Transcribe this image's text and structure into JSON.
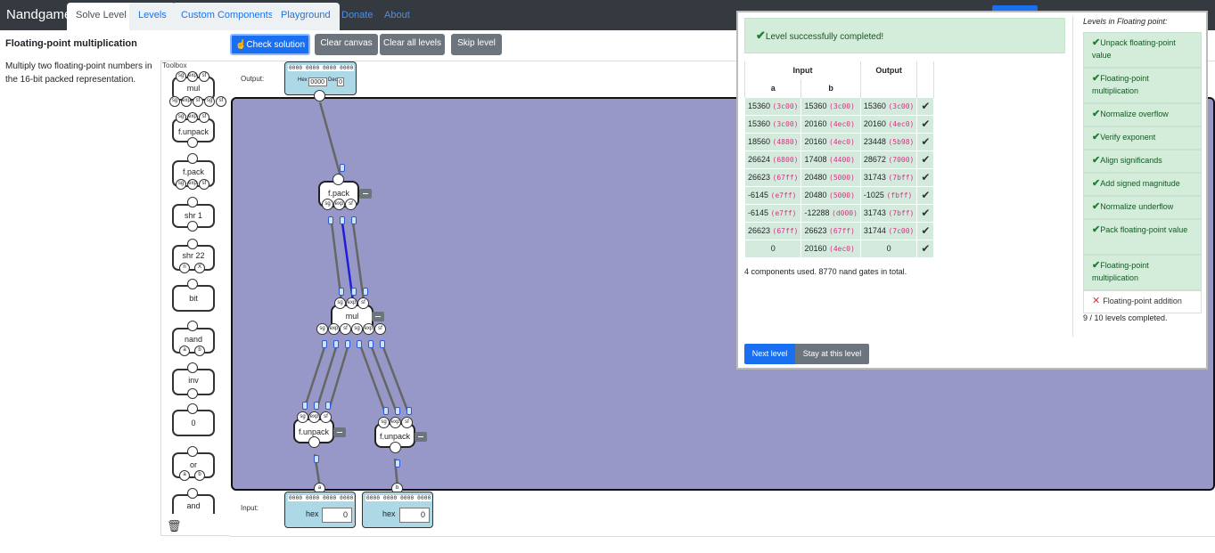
{
  "app": {
    "brand": "Nandgame",
    "tabs": [
      "Solve Level",
      "Levels",
      "Custom Components",
      "Playground",
      "Donate",
      "About"
    ]
  },
  "level": {
    "title": "Floating-point multiplication",
    "description": "Multiply two floating-point numbers in the 16-bit packed representation."
  },
  "toolbar": {
    "check": "Check solution",
    "clear_canvas": "Clear canvas",
    "clear_all": "Clear all levels",
    "skip": "Skip level"
  },
  "toolbox": {
    "label": "Toolbox",
    "items": [
      "mul",
      "f.unpack",
      "f.pack",
      "shr 1",
      "shr 22",
      "bit",
      "nand",
      "inv",
      "0",
      "or",
      "and"
    ],
    "pins": {
      "sg": "sg",
      "exp": "exp",
      "sf": "sf",
      "n": "n",
      "x": "X",
      "a": "a",
      "b": "b"
    }
  },
  "canvas": {
    "output_label": "Output:",
    "input_label": "Input:",
    "bits": "0000 0000 0000 0000",
    "output_hex_label": "Hex",
    "output_hex": "0000",
    "output_dec_label": "Dec",
    "output_dec": "0",
    "input_hex_label": "hex",
    "input_a_value": "0",
    "input_b_value": "0",
    "comp_fpack": "f.pack",
    "comp_mul": "mul",
    "comp_funpack": "f.unpack",
    "pin_sg": "sg",
    "pin_exp": "exp",
    "pin_sf": "sf",
    "pin_a": "a",
    "pin_b": "b"
  },
  "result": {
    "message": "Level successfully completed!",
    "headers": {
      "input": "Input",
      "output": "Output",
      "a": "a",
      "b": "b"
    },
    "rows": [
      {
        "a": "15360",
        "a_hex": "(3c00)",
        "b": "15360",
        "b_hex": "(3c00)",
        "out": "15360",
        "out_hex": "(3c00)"
      },
      {
        "a": "15360",
        "a_hex": "(3c00)",
        "b": "20160",
        "b_hex": "(4ec0)",
        "out": "20160",
        "out_hex": "(4ec0)"
      },
      {
        "a": "18560",
        "a_hex": "(4880)",
        "b": "20160",
        "b_hex": "(4ec0)",
        "out": "23448",
        "out_hex": "(5b98)"
      },
      {
        "a": "26624",
        "a_hex": "(6800)",
        "b": "17408",
        "b_hex": "(4400)",
        "out": "28672",
        "out_hex": "(7000)"
      },
      {
        "a": "26623",
        "a_hex": "(67ff)",
        "b": "20480",
        "b_hex": "(5000)",
        "out": "31743",
        "out_hex": "(7bff)"
      },
      {
        "a": "-6145",
        "a_hex": "(e7ff)",
        "b": "20480",
        "b_hex": "(5000)",
        "out": "-1025",
        "out_hex": "(fbff)"
      },
      {
        "a": "-6145",
        "a_hex": "(e7ff)",
        "b": "-12288",
        "b_hex": "(d000)",
        "out": "31743",
        "out_hex": "(7bff)"
      },
      {
        "a": "26623",
        "a_hex": "(67ff)",
        "b": "26623",
        "b_hex": "(67ff)",
        "out": "31744",
        "out_hex": "(7c00)"
      },
      {
        "a": "0",
        "a_hex": "",
        "b": "20160",
        "b_hex": "(4ec0)",
        "out": "0",
        "out_hex": ""
      }
    ],
    "summary": "4 components used. 8770 nand gates in total.",
    "next_button": "Next level",
    "stay_button": "Stay at this level"
  },
  "levels_panel": {
    "title": "Levels in Floating point:",
    "items": [
      {
        "label": "Unpack floating-point value",
        "done": true
      },
      {
        "label": "Floating-point multiplication",
        "done": true
      },
      {
        "label": "Normalize overflow",
        "done": true
      },
      {
        "label": "Verify exponent",
        "done": true
      },
      {
        "label": "Align significands",
        "done": true
      },
      {
        "label": "Add signed magnitude",
        "done": true
      },
      {
        "label": "Normalize underflow",
        "done": true
      },
      {
        "label": "Pack floating-point value",
        "done": true
      },
      {
        "label": "Floating-point multiplication",
        "done": true
      },
      {
        "label": "Floating-point addition",
        "done": false
      }
    ],
    "count": "9 / 10 levels completed."
  },
  "colors": {
    "navbar": "#343a40",
    "canvas": "#9898c8",
    "success": "#d4edda",
    "primary": "#1a6ff0",
    "wire": "#666666",
    "selected_wire": "#1f1fd6"
  }
}
